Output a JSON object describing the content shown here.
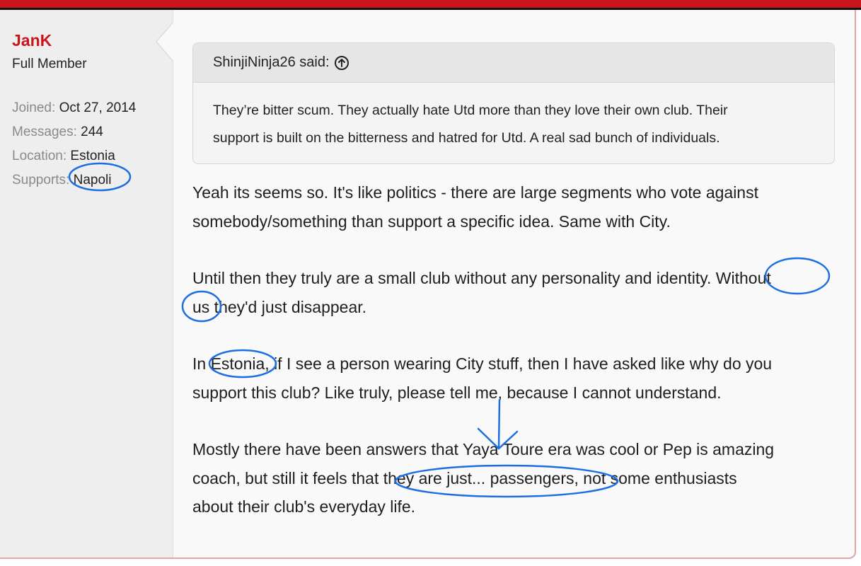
{
  "user": {
    "name": "JanK",
    "title": "Full Member",
    "stats": [
      {
        "label": "Joined:",
        "value": "Oct 27, 2014"
      },
      {
        "label": "Messages:",
        "value": "244"
      },
      {
        "label": "Location:",
        "value": "Estonia"
      },
      {
        "label": "Supports:",
        "value": "Napoli"
      }
    ]
  },
  "quote": {
    "author_said": "ShinjiNinja26 said:",
    "icon": "arrow-up-circle-icon",
    "lines": [
      "They’re bitter scum. They actually hate Utd more than they love their own club. Their",
      "support is built on the bitterness and hatred for Utd. A real sad bunch of individuals."
    ]
  },
  "message": {
    "paragraphs": [
      [
        "Yeah its seems so. It's like politics - there are large segments who vote against",
        "somebody/something than support a specific idea. Same with City."
      ],
      [
        "Until then they truly are a small club without any personality and identity. Without",
        "us they'd just disappear."
      ],
      [
        "In Estonia, if I see a person wearing City stuff, then I have asked like why do you",
        "support this club? Like truly, please tell me, because I cannot understand."
      ],
      [
        "Mostly there have been answers that Yaya Toure era was cool or Pep is amazing",
        "coach, but still it feels that they are just... passengers, not some enthusiasts",
        "about their club's everyday life."
      ]
    ]
  },
  "colors": {
    "brand_red": "#c8151b",
    "annotation_blue": "#1c6fe3"
  }
}
